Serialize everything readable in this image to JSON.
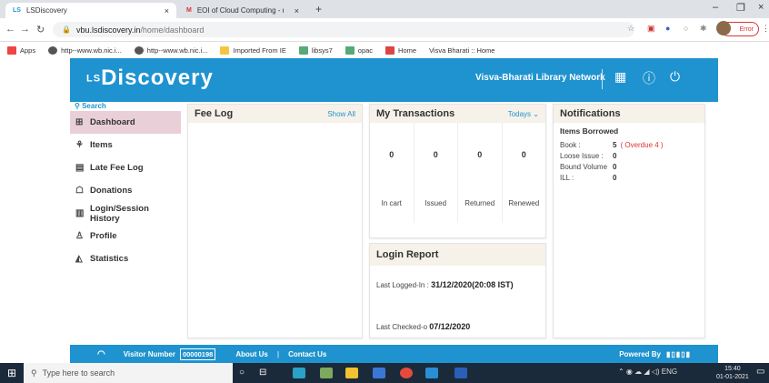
{
  "browser": {
    "tabs": [
      {
        "favicon": "LS",
        "title": "LSDiscovery",
        "close": "×"
      },
      {
        "favicon": "M",
        "title": "EOI of Cloud Computing - ncsah...",
        "close": "×"
      }
    ],
    "new_tab": "+",
    "url_host": "vbu.lsdiscovery.in",
    "url_path": "/home/dashboard",
    "error_label": "Error",
    "bookmarks": [
      "Apps",
      "http--www.wb.nic.i...",
      "http--www.wb.nic.i...",
      "Imported From IE",
      "libsys7",
      "opac",
      "Home",
      "Visva Bharati :: Home"
    ]
  },
  "header": {
    "logo_prefix": "LS",
    "logo_text": "Discovery",
    "network_name": "Visva-Bharati Library Network"
  },
  "sidebar": {
    "search_label": "Search",
    "items": [
      {
        "label": "Dashboard",
        "icon": "dashboard-icon"
      },
      {
        "label": "Items",
        "icon": "items-icon"
      },
      {
        "label": "Late Fee Log",
        "icon": "fee-log-icon"
      },
      {
        "label": "Donations",
        "icon": "donations-icon"
      },
      {
        "label": "Login/Session History",
        "icon": "history-icon"
      },
      {
        "label": "Profile",
        "icon": "profile-icon"
      },
      {
        "label": "Statistics",
        "icon": "statistics-icon"
      }
    ]
  },
  "fee_log": {
    "title": "Fee Log",
    "show_all": "Show All"
  },
  "transactions": {
    "title": "My Transactions",
    "period": "Todays",
    "columns": [
      {
        "value": "0",
        "label": "In cart"
      },
      {
        "value": "0",
        "label": "Issued"
      },
      {
        "value": "0",
        "label": "Returned"
      },
      {
        "value": "0",
        "label": "Renewed"
      }
    ]
  },
  "login_report": {
    "title": "Login Report",
    "last_logged_in_label": "Last Logged-In :",
    "last_logged_in_value": "31/12/2020(20:08 IST)",
    "last_checked_label": "Last Checked-o",
    "last_checked_value": "07/12/2020"
  },
  "notifications": {
    "title": "Notifications",
    "heading": "Items Borrowed",
    "book_label": "Book :",
    "book_value": "5",
    "book_overdue": "( Overdue 4 )",
    "loose_label": "Loose Issue :",
    "loose_value": "0",
    "bound_label": "Bound Volume",
    "bound_value": "0",
    "ill_label": "ILL :",
    "ill_value": "0"
  },
  "footer": {
    "visitor_label": "Visitor Number",
    "visitor_value": "00000198",
    "about": "About Us",
    "contact": "Contact Us",
    "powered": "Powered By"
  },
  "taskbar": {
    "search_placeholder": "Type here to search",
    "lang": "ENG",
    "time": "15:40",
    "date": "01-01-2021"
  },
  "colors": {
    "primary": "#1f93cf",
    "active_menu": "#e9cfd7",
    "overdue": "#dd3333"
  }
}
